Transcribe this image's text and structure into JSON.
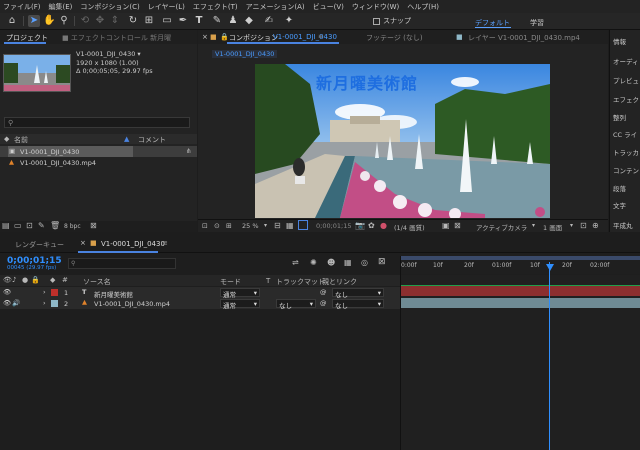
{
  "menu": [
    "ファイル(F)",
    "編集(E)",
    "コンポジション(C)",
    "レイヤー(L)",
    "エフェクト(T)",
    "アニメーション(A)",
    "ビュー(V)",
    "ウィンドウ(W)",
    "ヘルプ(H)"
  ],
  "toolbar": {
    "snap_label": "スナップ",
    "workspace_default": "デフォルト",
    "workspace_learn": "学習"
  },
  "project": {
    "tab_label": "プロジェクト",
    "effect_tab_label": "エフェクトコントロール 新月曜",
    "info_name": "V1-0001_DJI_0430 ▾",
    "info_size": "1920 x 1080 (1.00)",
    "info_duration": "Δ 0;00;05;05, 29.97 fps",
    "search_placeholder": "",
    "col_name": "名前",
    "col_comment": "コメント",
    "items": [
      {
        "name": "V1-0001_DJI_0430"
      },
      {
        "name": "V1-0001_DJI_0430.mp4"
      }
    ],
    "bpc": "8 bpc"
  },
  "composition": {
    "tab_label": "コンポジション",
    "tab_name": "V1-0001_DJI_0430",
    "footage_tab": "フッテージ (なし)",
    "layer_tab": "レイヤー V1-0001_DJI_0430.mp4",
    "breadcrumb": "V1-0001_DJI_0430",
    "overlay_title": "新月曜美術館",
    "zoom": "25 %",
    "timecode": "0;00;01;15",
    "resolution": "(1/4 画質)",
    "camera": "アクティブカメラ",
    "view": "1 画面"
  },
  "right_panel": [
    "情報",
    "オーディ",
    "プレビュ",
    "エフェク",
    "整列",
    "CC ライ",
    "トラッカ",
    "コンテン",
    "段落",
    "文字",
    "平成丸"
  ],
  "timeline": {
    "render_tab": "レンダーキュー",
    "comp_tab": "V1-0001_DJI_0430",
    "current_time": "0;00;01;15",
    "fps_note": "00045 (29.97 fps)",
    "col_source": "ソース名",
    "col_mode": "モード",
    "col_t": "T",
    "col_trackmatte": "トラックマット",
    "col_parent": "親とリンク",
    "ruler_ticks": [
      "0:00f",
      "10f",
      "20f",
      "01:00f",
      "10f",
      "20f",
      "02:00f"
    ],
    "layers": [
      {
        "num": "1",
        "type": "T",
        "name": "新月曜美術館",
        "mode": "通常",
        "matte": "",
        "parent": "なし",
        "color": "#c0302b"
      },
      {
        "num": "2",
        "type": "video",
        "name": "V1-0001_DJI_0430.mp4",
        "mode": "通常",
        "matte": "なし",
        "parent": "なし",
        "color": "#8fb8c8"
      }
    ]
  }
}
